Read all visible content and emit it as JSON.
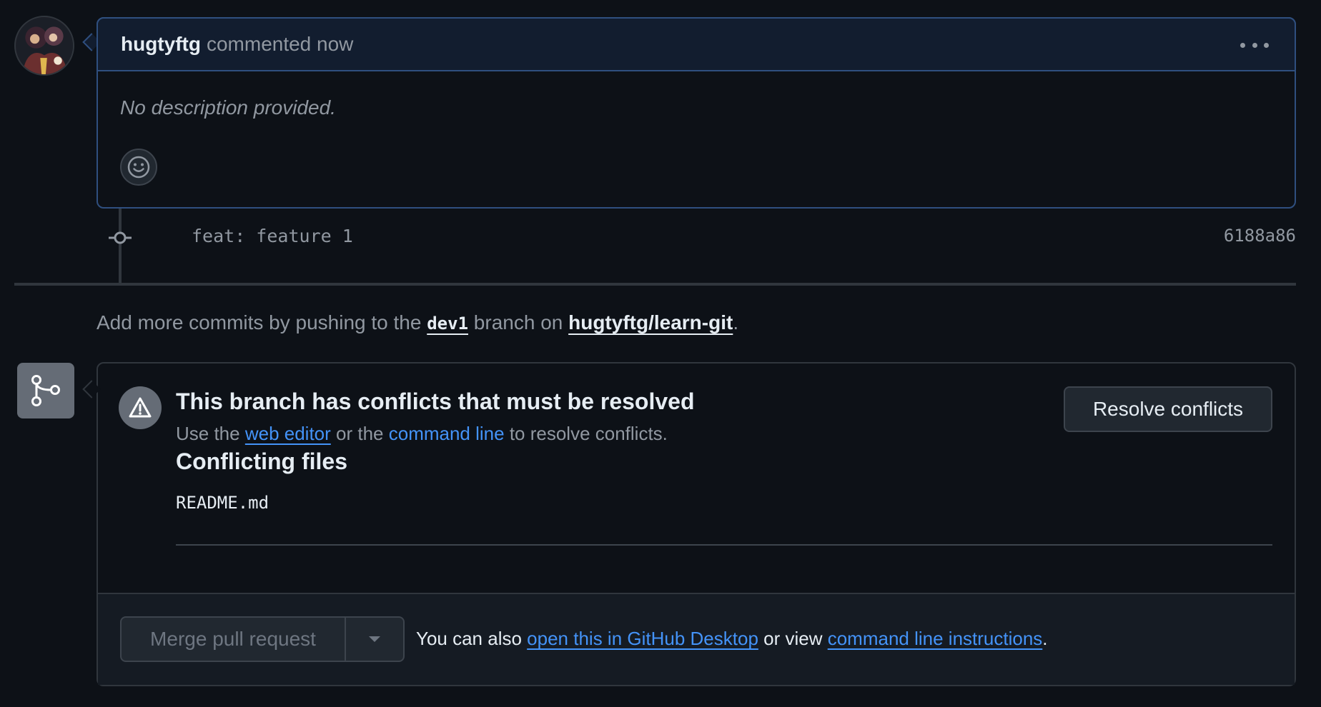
{
  "comment": {
    "author": "hugtyftg",
    "meta": "commented now",
    "body": "No description provided.",
    "menu_icon": "kebab-horizontal-icon",
    "reaction_icon": "smiley-icon"
  },
  "commit": {
    "icon": "git-commit-icon",
    "message": "feat: feature 1",
    "sha": "6188a86"
  },
  "push_hint": {
    "prefix": "Add more commits by pushing to the ",
    "branch": "dev1",
    "middle": " branch on ",
    "repo": "hugtyftg/learn-git",
    "suffix": "."
  },
  "merge": {
    "status_icon": "git-branch-icon",
    "warning_icon": "alert-icon",
    "title": "This branch has conflicts that must be resolved",
    "sub_prefix": "Use the ",
    "web_editor_link": "web editor",
    "sub_middle": " or the ",
    "command_line_link": "command line",
    "sub_suffix": " to resolve conflicts.",
    "resolve_button": "Resolve conflicts",
    "conflicting_files_title": "Conflicting files",
    "files": [
      "README.md"
    ],
    "merge_button": "Merge pull request",
    "dropdown_icon": "triangle-down-icon",
    "footer_prefix": "You can also ",
    "desktop_link": "open this in GitHub Desktop",
    "footer_middle": " or view ",
    "instructions_link": "command line instructions",
    "footer_suffix": "."
  },
  "colors": {
    "background": "#0d1117",
    "link": "#4493f8",
    "muted": "#9198a1",
    "border": "#30363d",
    "comment_border": "#2f4f7f"
  }
}
